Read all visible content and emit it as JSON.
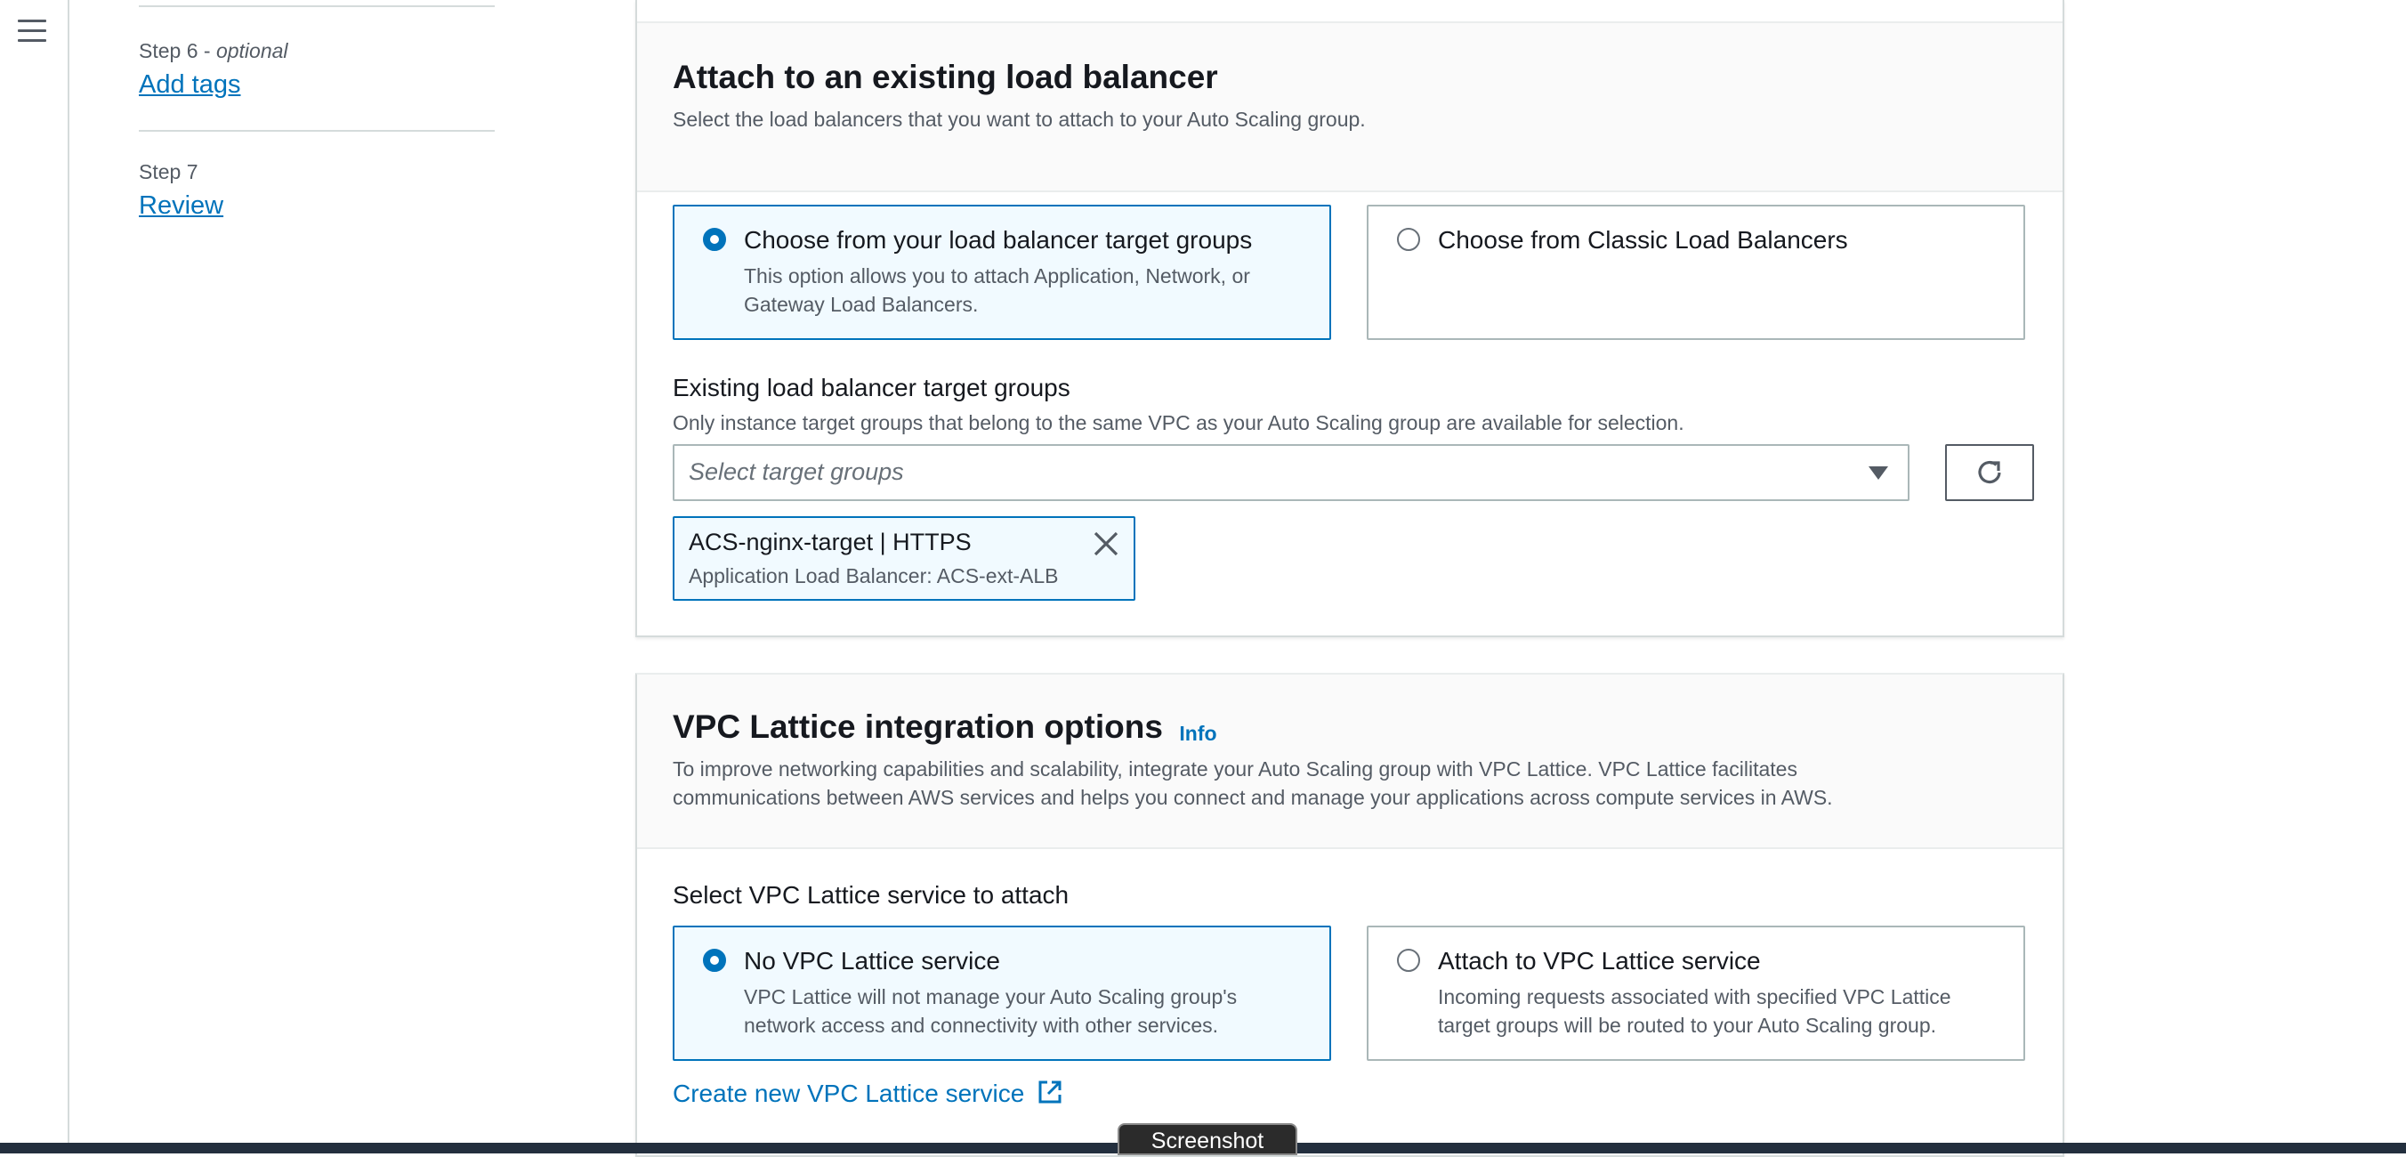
{
  "sidebar": {
    "steps": [
      {
        "step": "Step 6",
        "suffix": " - ",
        "qualifier": "optional",
        "link": "Add tags"
      },
      {
        "step": "Step 7",
        "link": "Review"
      }
    ]
  },
  "load_balancer": {
    "title": "Attach to an existing load balancer",
    "description": "Select the load balancers that you want to attach to your Auto Scaling group.",
    "options": [
      {
        "title": "Choose from your load balancer target groups",
        "description": "This option allows you to attach Application, Network, or Gateway Load Balancers.",
        "selected": true
      },
      {
        "title": "Choose from Classic Load Balancers",
        "description": "",
        "selected": false
      }
    ],
    "target_groups_label": "Existing load balancer target groups",
    "target_groups_desc": "Only instance target groups that belong to the same VPC as your Auto Scaling group are available for selection.",
    "select_placeholder": "Select target groups",
    "selected_token": {
      "title": "ACS-nginx-target | HTTPS",
      "subtitle": "Application Load Balancer: ACS-ext-ALB"
    }
  },
  "vpc_lattice": {
    "title": "VPC Lattice integration options",
    "info": "Info",
    "description": "To improve networking capabilities and scalability, integrate your Auto Scaling group with VPC Lattice. VPC Lattice facilitates communications between AWS services and helps you connect and manage your applications across compute services in AWS.",
    "select_label": "Select VPC Lattice service to attach",
    "options": [
      {
        "title": "No VPC Lattice service",
        "description": "VPC Lattice will not manage your Auto Scaling group's network access and connectivity with other services.",
        "selected": true
      },
      {
        "title": "Attach to VPC Lattice service",
        "description": "Incoming requests associated with specified VPC Lattice target groups will be routed to your Auto Scaling group.",
        "selected": false
      }
    ],
    "create_link": "Create new VPC Lattice service"
  },
  "overlay": {
    "screenshot_tab": "Screenshot"
  },
  "colors": {
    "link": "#0073bb",
    "selected_bg": "#f1faff",
    "bottom_bar": "#232f3e"
  }
}
